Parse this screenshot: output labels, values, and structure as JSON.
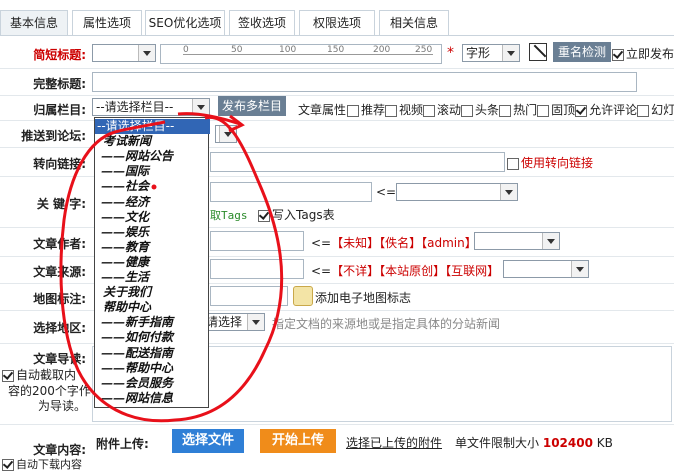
{
  "tabs": [
    "基本信息",
    "属性选项",
    "SEO优化选项",
    "签收选项",
    "权限选项",
    "相关信息"
  ],
  "labels": {
    "short_title": "简短标题:",
    "full_title": "完整标题:",
    "column": "归属栏目:",
    "forum": "推送到论坛:",
    "redirect": "转向链接:",
    "keywords": "关 键 字:",
    "author": "文章作者:",
    "source": "文章来源:",
    "map": "地图标注:",
    "region": "选择地区:",
    "summary": "文章导读:",
    "content": "文章内容:"
  },
  "short_title": {
    "font_select": "字形",
    "dup_button": "重名检测",
    "publish_now": "立即发布",
    "ruler": [
      "0",
      "50",
      "100",
      "150",
      "200",
      "250"
    ]
  },
  "column": {
    "select": "--请选择栏目--",
    "multi_button": "发布多栏目",
    "attr_label": "文章属性",
    "attrs": [
      {
        "label": "推荐",
        "checked": false
      },
      {
        "label": "视频",
        "checked": false
      },
      {
        "label": "滚动",
        "checked": false
      },
      {
        "label": "头条",
        "checked": false
      },
      {
        "label": "热门",
        "checked": false
      },
      {
        "label": "固顶",
        "checked": false
      },
      {
        "label": "允许评论",
        "checked": true
      },
      {
        "label": "幻灯",
        "checked": false
      }
    ]
  },
  "redirect": {
    "use_label": "使用转向链接"
  },
  "keywords": {
    "get_tags": "取Tags",
    "write_tags": "写入Tags表",
    "arrow": "<="
  },
  "author": {
    "arrow": "<=",
    "opts": [
      "【未知】",
      "【佚名】",
      "【admin】"
    ]
  },
  "source": {
    "arrow": "<=",
    "opts": [
      "【不详】",
      "【本站原创】",
      "【互联网】"
    ]
  },
  "map": {
    "add": "添加电子地图标志"
  },
  "region": {
    "select": "请选择",
    "hint": "指定文档的来源地或是指定具体的分站新闻"
  },
  "summary": {
    "auto": "自动截取内容的200个字作为导读。",
    "lines": [
      "自动截取内",
      "容的200个字作",
      "为导读。"
    ]
  },
  "content": {
    "auto": "自动下载内容"
  },
  "attach": {
    "label": "附件上传:",
    "choose": "选择文件",
    "start": "开始上传",
    "uploaded": "选择已上传的附件",
    "limit_pre": "单文件限制大小",
    "limit_val": "102400",
    "limit_unit": "KB"
  },
  "dropdown": [
    {
      "label": "--请选择栏目--",
      "level": 0,
      "highlight": true
    },
    {
      "label": "考试新闻",
      "level": 0
    },
    {
      "label": "网站公告",
      "level": 1
    },
    {
      "label": "国际",
      "level": 1
    },
    {
      "label": "社会",
      "level": 1
    },
    {
      "label": "经济",
      "level": 1
    },
    {
      "label": "文化",
      "level": 1
    },
    {
      "label": "娱乐",
      "level": 1
    },
    {
      "label": "教育",
      "level": 1
    },
    {
      "label": "健康",
      "level": 1
    },
    {
      "label": "生活",
      "level": 1
    },
    {
      "label": "关于我们",
      "level": 0
    },
    {
      "label": "帮助中心",
      "level": 0
    },
    {
      "label": "新手指南",
      "level": 1
    },
    {
      "label": "如何付款",
      "level": 1
    },
    {
      "label": "配送指南",
      "level": 1
    },
    {
      "label": "帮助中心",
      "level": 1
    },
    {
      "label": "会员服务",
      "level": 1
    },
    {
      "label": "网站信息",
      "level": 1
    }
  ],
  "colors": {
    "accent_red": "#c00",
    "button_blue": "#2f7fd6",
    "button_orange": "#f08c1a",
    "annotation": "#e8101a"
  }
}
